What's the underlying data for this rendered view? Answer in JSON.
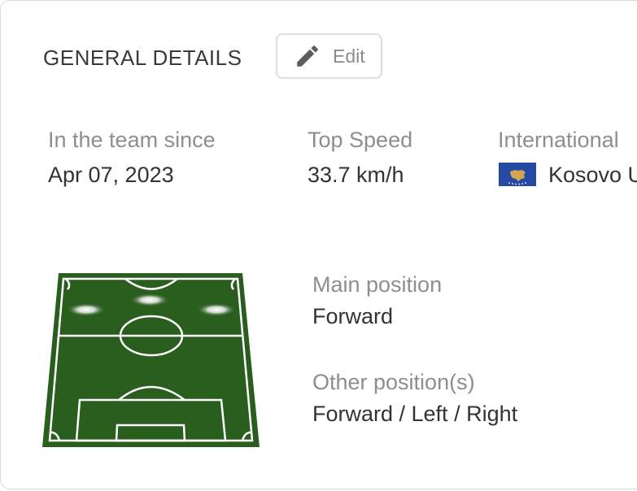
{
  "section": {
    "title": "GENERAL DETAILS",
    "edit_label": "Edit"
  },
  "details": [
    {
      "label": "In the team since",
      "value": "Apr 07, 2023"
    },
    {
      "label": "Top Speed",
      "value": "33.7 km/h"
    },
    {
      "label": "International",
      "value": "Kosovo U"
    }
  ],
  "positions": {
    "main_label": "Main position",
    "main_value": "Forward",
    "other_label": "Other position(s)",
    "other_value": "Forward / Left / Right"
  },
  "colors": {
    "pitch": "#2a5e1f",
    "flag_blue": "#244aa5",
    "flag_gold": "#d0a650"
  },
  "icons": {
    "edit": "pencil-icon",
    "flag": "kosovo-flag-icon"
  }
}
